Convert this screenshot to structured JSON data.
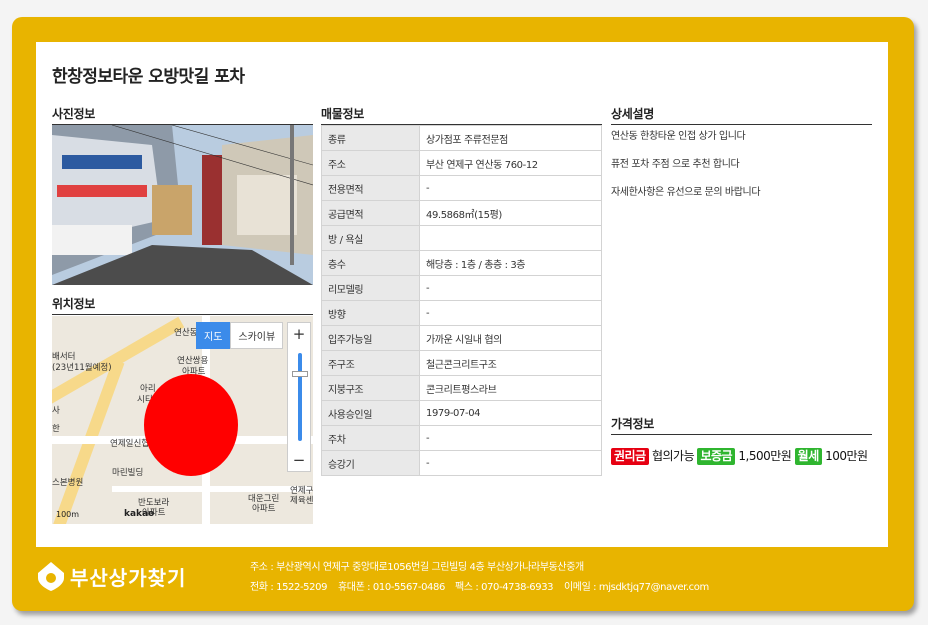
{
  "title": "한창정보타운 오방맛길 포차",
  "sections": {
    "photo": "사진정보",
    "location": "위치정보",
    "listing": "매물정보",
    "detail": "상세설명",
    "price": "가격정보"
  },
  "map": {
    "map_button": "지도",
    "skyview_button": "스카이뷰",
    "zoom_in": "+",
    "zoom_out": "−",
    "scale": "100m",
    "brand": "kakao",
    "labels": [
      "연산동",
      "연산쌍용",
      "아파트",
      "연제일신협",
      "마린빌딩",
      "반도보라",
      "아파트",
      "대운그린",
      "아파트",
      "제육센",
      "연제구",
      "스본병원",
      "배서터",
      "(23년11월예정)",
      "아리",
      "시티",
      "한",
      "사"
    ]
  },
  "listing": [
    {
      "key": "종류",
      "value": "상가점포 주류전문점"
    },
    {
      "key": "주소",
      "value": "부산 연제구 연산동 760-12"
    },
    {
      "key": "전용면적",
      "value": "-"
    },
    {
      "key": "공급면적",
      "value": "49.5868㎡(15평)"
    },
    {
      "key": "방 / 욕실",
      "value": ""
    },
    {
      "key": "층수",
      "value": "해당층 : 1층 / 총층 : 3층"
    },
    {
      "key": "리모델링",
      "value": "-"
    },
    {
      "key": "방향",
      "value": "-"
    },
    {
      "key": "입주가능일",
      "value": "가까운 시일내 협의"
    },
    {
      "key": "주구조",
      "value": "철근콘크리트구조"
    },
    {
      "key": "지붕구조",
      "value": "콘크리트평스라브"
    },
    {
      "key": "사용승인일",
      "value": "1979-07-04"
    },
    {
      "key": "주차",
      "value": "-"
    },
    {
      "key": "승강기",
      "value": "-"
    }
  ],
  "description": [
    "연산동 한창타운 인접 상가 입니다",
    "퓨전 포차 주점 으로 추천 합니다",
    "자세한사항은 유선으로 문의 바랍니다"
  ],
  "price": {
    "premium_label": "권리금",
    "premium_value": "협의가능",
    "deposit_label": "보증금",
    "deposit_value": "1,500만원",
    "rent_label": "월세",
    "rent_value": "100만원"
  },
  "footer": {
    "logo": "부산상가찾기",
    "address": "주소 : 부산광역시 연제구 중앙대로1056번길 그린빌딩 4층 부산상가나라부동산중개",
    "phone": "전화 : 1522-5209",
    "mobile": "휴대폰 : 010-5567-0486",
    "fax": "팩스 : 070-4738-6933",
    "email": "이메일 : mjsdktjq77@naver.com"
  },
  "colors": {
    "frame": "#e8b400",
    "map_active": "#3b8bea",
    "premium": "#e60012",
    "deposit": "#2fb52f",
    "marker": "#ff0000"
  }
}
